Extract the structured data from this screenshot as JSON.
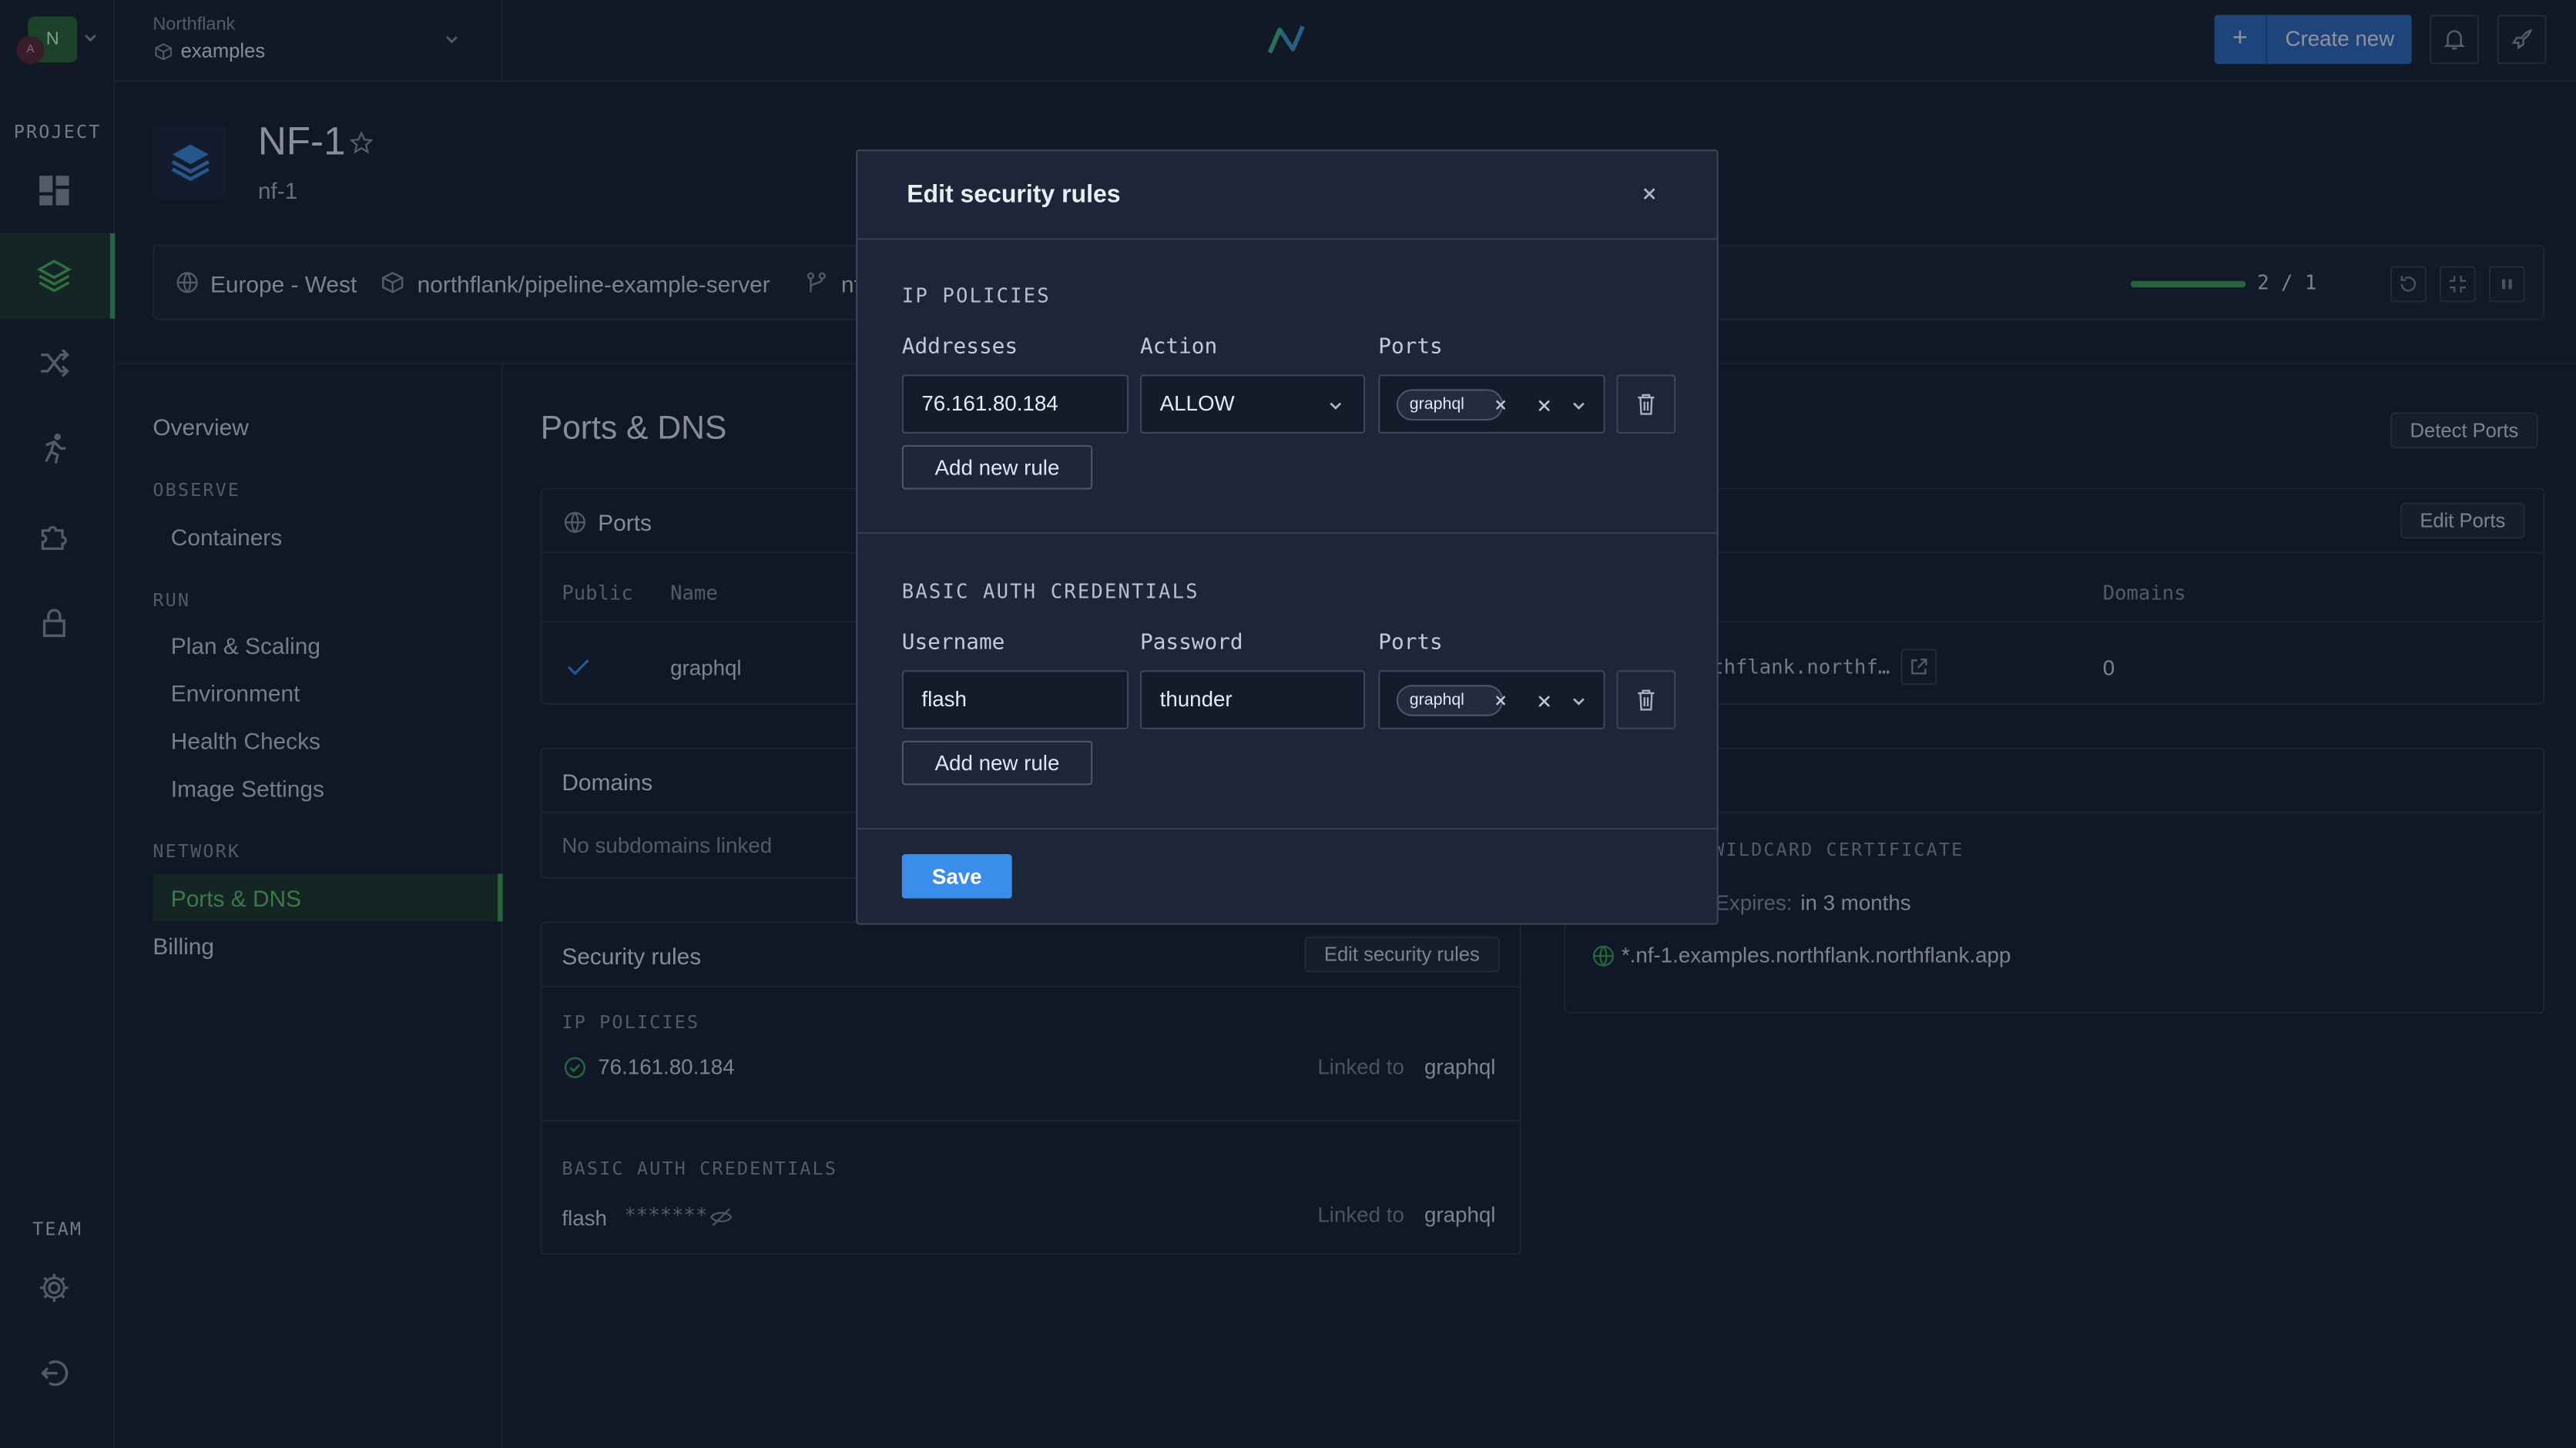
{
  "org": {
    "name": "Northflank",
    "project": "examples",
    "avatar_letter": "N",
    "avatar_small": "A"
  },
  "header": {
    "create_label": "Create new"
  },
  "rail": {
    "project_label": "PROJECT",
    "team_label": "TEAM"
  },
  "service": {
    "name": "NF-1",
    "slug": "nf-1"
  },
  "infobar": {
    "region": "Europe - West",
    "repo": "northflank/pipeline-example-server",
    "branch": "nf",
    "instances": "2 / 1",
    "instance_fill": 1.0
  },
  "nav": {
    "overview": "Overview",
    "observe_label": "OBSERVE",
    "containers": "Containers",
    "run_label": "RUN",
    "plan": "Plan & Scaling",
    "environment": "Environment",
    "health": "Health Checks",
    "image": "Image Settings",
    "network_label": "NETWORK",
    "ports_dns": "Ports & DNS",
    "billing": "Billing"
  },
  "page": {
    "title": "Ports & DNS",
    "detect_ports": "Detect Ports",
    "edit_ports": "Edit Ports",
    "ports": {
      "title": "Ports",
      "col_public": "Public",
      "col_name": "Name",
      "col_domains": "Domains",
      "row_name": "graphql",
      "row_dns": "thflank.northf…",
      "row_domains": "0"
    },
    "domains": {
      "title": "Domains",
      "empty": "No subdomains linked"
    },
    "cert": {
      "label": "WILDCARD CERTIFICATE",
      "expires_label": "Expires:",
      "expires_value": "in 3 months",
      "domain": "*.nf-1.examples.northflank.northflank.app"
    },
    "security": {
      "title": "Security rules",
      "edit_button": "Edit security rules",
      "ip_label": "IP POLICIES",
      "ip_address": "76.161.80.184",
      "linked_label": "Linked to",
      "linked_value": "graphql",
      "auth_label": "BASIC AUTH CREDENTIALS",
      "auth_user": "flash",
      "auth_mask": "*******",
      "auth_linked_label": "Linked to",
      "auth_linked_value": "graphql"
    }
  },
  "modal": {
    "title": "Edit security rules",
    "ip_section": "IP POLICIES",
    "col_addresses": "Addresses",
    "col_action": "Action",
    "col_ports": "Ports",
    "ip_address": "76.161.80.184",
    "ip_action": "ALLOW",
    "ip_port_chip": "graphql",
    "add_rule": "Add new rule",
    "auth_section": "BASIC AUTH CREDENTIALS",
    "col_username": "Username",
    "col_password": "Password",
    "col_ports2": "Ports",
    "username": "flash",
    "password": "thunder",
    "auth_port_chip": "graphql",
    "add_rule2": "Add new rule",
    "save": "Save"
  }
}
